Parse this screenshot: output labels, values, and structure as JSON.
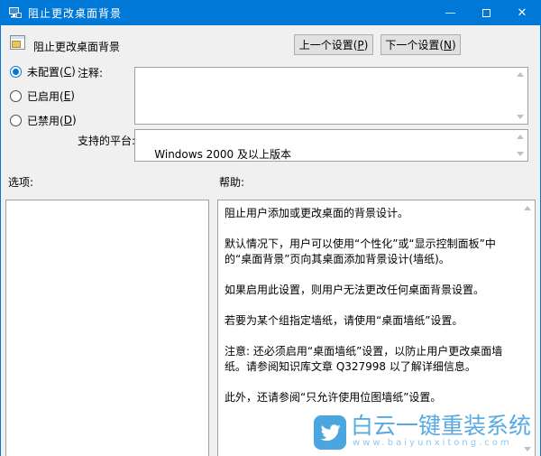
{
  "window": {
    "title": "阻止更改桌面背景",
    "icons": {
      "close_glyph": "✕"
    }
  },
  "header": {
    "setting_title": "阻止更改桌面背景",
    "prev_button": {
      "prefix": "上一个设置(",
      "key": "P",
      "suffix": ")"
    },
    "next_button": {
      "prefix": "下一个设置(",
      "key": "N",
      "suffix": ")"
    }
  },
  "config": {
    "radios": [
      {
        "prefix": "未配置(",
        "key": "C",
        "suffix": ")",
        "selected": true
      },
      {
        "prefix": "已启用(",
        "key": "E",
        "suffix": ")",
        "selected": false
      },
      {
        "prefix": "已禁用(",
        "key": "D",
        "suffix": ")",
        "selected": false
      }
    ],
    "comment_label": "注释:",
    "comment_value": "",
    "platform_label": "支持的平台:",
    "platform_value": "Windows 2000 及以上版本"
  },
  "panels": {
    "options_label": "选项:",
    "help_label": "帮助:",
    "help_paragraphs": [
      "阻止用户添加或更改桌面的背景设计。",
      "默认情况下，用户可以使用“个性化”或“显示控制面板”中的“桌面背景”页向其桌面添加背景设计(墙纸)。",
      "如果启用此设置，则用户无法更改任何桌面背景设置。",
      "若要为某个组指定墙纸，请使用“桌面墙纸”设置。",
      "注意: 还必须启用“桌面墙纸”设置，以防止用户更改桌面墙纸。请参阅知识库文章 Q327998 以了解详细信息。",
      "此外，还请参阅“只允许使用位图墙纸”设置。"
    ]
  },
  "watermark": {
    "brand": "白云一键重装系统",
    "url": "www.baiyunxitong.com",
    "colors": {
      "logo_bg": "#4ba6e0",
      "brand_text": "#58aae3",
      "url_text": "#8ec9ef"
    }
  },
  "colors": {
    "titlebar": "#0078d7",
    "window_bg": "#f0f0f0"
  }
}
